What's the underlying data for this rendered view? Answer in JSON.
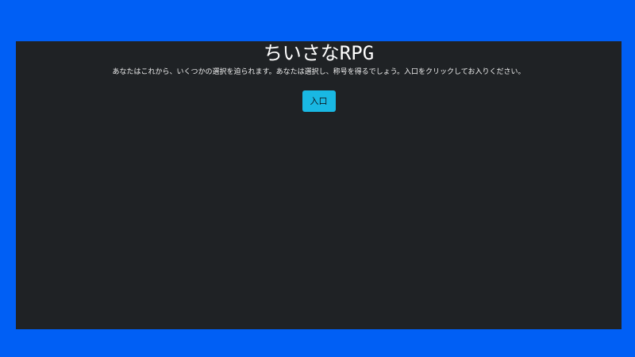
{
  "game": {
    "title": "ちいさなRPG",
    "intro": "あなたはこれから、いくつかの選択を迫られます。あなたは選択し、称号を得るでしょう。入口をクリックしてお入りください。",
    "enter_label": "入口"
  },
  "colors": {
    "background": "#005ff5",
    "panel": "#1f2225",
    "button": "#19b8e3"
  }
}
